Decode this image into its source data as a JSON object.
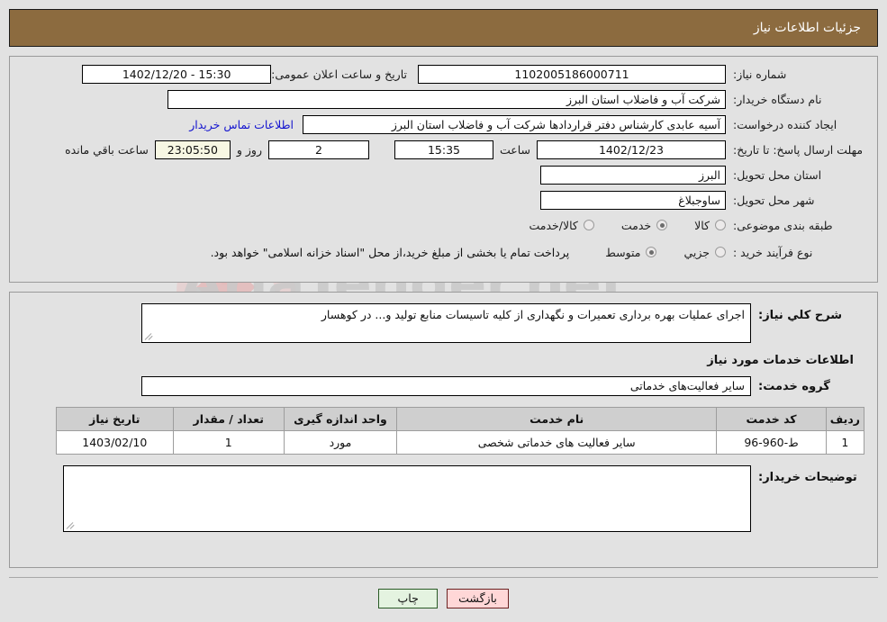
{
  "header": {
    "title": "جزئیات اطلاعات نیاز"
  },
  "panel1": {
    "need_number": {
      "label": "شماره نیاز:",
      "value": "1102005186000711"
    },
    "announce": {
      "label": "تاریخ و ساعت اعلان عمومی:",
      "value": "15:30 - 1402/12/20"
    },
    "buyer_org": {
      "label": "نام دستگاه خریدار:",
      "value": "شرکت آب و فاضلاب استان البرز"
    },
    "creator": {
      "label": "ایجاد کننده درخواست:",
      "value": "آسیه عابدی کارشناس دفتر قراردادها شرکت آب و فاضلاب استان البرز"
    },
    "contact_link": "اطلاعات تماس خریدار",
    "deadline": {
      "label": "مهلت ارسال پاسخ: تا تاریخ:",
      "date": "1402/12/23",
      "time_label": "ساعت",
      "time": "15:35",
      "days": "2",
      "days_label": "روز و",
      "countdown": "23:05:50",
      "remaining_label": "ساعت باقي مانده"
    },
    "province": {
      "label": "استان محل تحویل:",
      "value": "البرز"
    },
    "city": {
      "label": "شهر محل تحویل:",
      "value": "ساوجبلاغ"
    },
    "category": {
      "label": "طبقه بندی موضوعی:",
      "options": [
        {
          "label": "کالا",
          "selected": false
        },
        {
          "label": "خدمت",
          "selected": true
        },
        {
          "label": "کالا/خدمت",
          "selected": false
        }
      ]
    },
    "process": {
      "label": "نوع فرآیند خرید :",
      "options": [
        {
          "label": "جزیي",
          "selected": false
        },
        {
          "label": "متوسط",
          "selected": true
        }
      ],
      "note": "پرداخت تمام یا بخشی از مبلغ خرید،از محل \"اسناد خزانه اسلامی\" خواهد بود."
    }
  },
  "panel2": {
    "description": {
      "label": "شرح کلي نیاز:",
      "value": "اجرای عملیات بهره برداری تعمیرات و نگهداری از کلیه تاسیسات منابع تولید و... در کوهسار"
    },
    "services_title": "اطلاعات خدمات مورد نیاز",
    "service_group": {
      "label": "گروه خدمت:",
      "value": "سایر فعالیت‌های خدماتی"
    },
    "table": {
      "columns": [
        "ردیف",
        "کد خدمت",
        "نام خدمت",
        "واحد اندازه گیری",
        "تعداد / مقدار",
        "تاریخ نیاز"
      ],
      "rows": [
        {
          "radif": "1",
          "code": "ط-960-96",
          "name": "سایر فعالیت های خدماتی شخصی",
          "unit": "مورد",
          "qty": "1",
          "date": "1403/02/10"
        }
      ]
    },
    "buyer_notes": {
      "label": "توضیحات خریدار:",
      "value": ""
    }
  },
  "footer": {
    "back_button": "بازگشت",
    "print_button": "چاپ"
  },
  "watermark": {
    "text": "AriaTender.net"
  }
}
